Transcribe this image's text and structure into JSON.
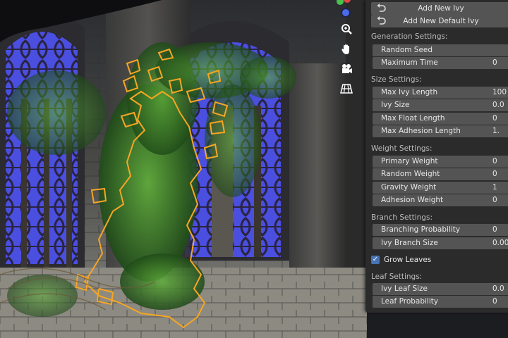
{
  "panel": {
    "buttons": {
      "add_new_ivy": "Add New Ivy",
      "add_new_default_ivy": "Add New Default Ivy"
    },
    "generation": {
      "header": "Generation Settings:",
      "random_seed": {
        "label": "Random Seed",
        "value": ""
      },
      "maximum_time": {
        "label": "Maximum Time",
        "value": "0"
      }
    },
    "size": {
      "header": "Size Settings:",
      "max_ivy_length": {
        "label": "Max Ivy Length",
        "value": "100"
      },
      "ivy_size": {
        "label": "Ivy Size",
        "value": "0.0"
      },
      "max_float_length": {
        "label": "Max Float Length",
        "value": "0"
      },
      "max_adhesion_length": {
        "label": "Max Adhesion Length",
        "value": "1."
      }
    },
    "weight": {
      "header": "Weight Settings:",
      "primary_weight": {
        "label": "Primary Weight",
        "value": "0"
      },
      "random_weight": {
        "label": "Random Weight",
        "value": "0"
      },
      "gravity_weight": {
        "label": "Gravity Weight",
        "value": "1"
      },
      "adhesion_weight": {
        "label": "Adhesion Weight",
        "value": "0"
      }
    },
    "branch": {
      "header": "Branch Settings:",
      "branching_probability": {
        "label": "Branching Probability",
        "value": "0"
      },
      "ivy_branch_size": {
        "label": "Ivy Branch Size",
        "value": "0.00"
      }
    },
    "grow_leaves": {
      "label": "Grow Leaves",
      "checked": true
    },
    "leaf": {
      "header": "Leaf Settings:",
      "ivy_leaf_size": {
        "label": "Ivy Leaf Size",
        "value": "0.0"
      },
      "leaf_probability": {
        "label": "Leaf Probability",
        "value": "0"
      }
    }
  },
  "colors": {
    "panel_bg": "#2b2b2b",
    "field_bg": "#545454",
    "selection_outline": "#f5a623",
    "window_glass": "#4a4fe0",
    "checkbox": "#4772b3"
  },
  "icons": {
    "gizmo": [
      "axis-x-red",
      "axis-y-green",
      "axis-z-blue"
    ],
    "tools": [
      "zoom-icon",
      "hand-pan-icon",
      "camera-icon",
      "grid-icon"
    ]
  }
}
